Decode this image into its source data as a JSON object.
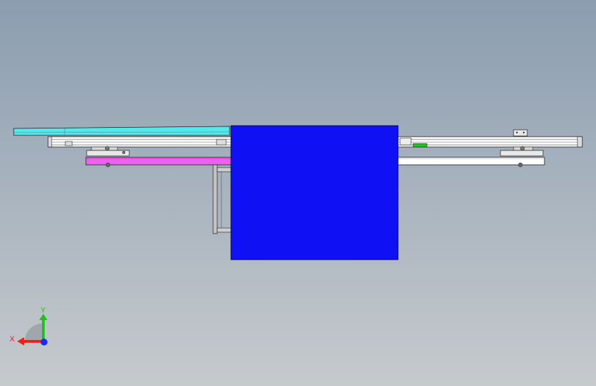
{
  "viewport": {
    "background_top": "#8b9db0",
    "background_bottom": "#c6cacd"
  },
  "model": {
    "part_colors": {
      "cyan_rail": "#54e8ec",
      "magenta_bar": "#f060f0",
      "blue_block": "#1010f5",
      "green_marker": "#1ec81e",
      "frame_white": "#ffffff",
      "frame_gray": "#c4c4c4",
      "outline": "#1a1a1a"
    }
  },
  "triad": {
    "x_label": "X",
    "y_label": "Y",
    "x_color": "#ff1a1a",
    "y_color": "#1fbf1f",
    "z_color": "#1a2bff"
  }
}
